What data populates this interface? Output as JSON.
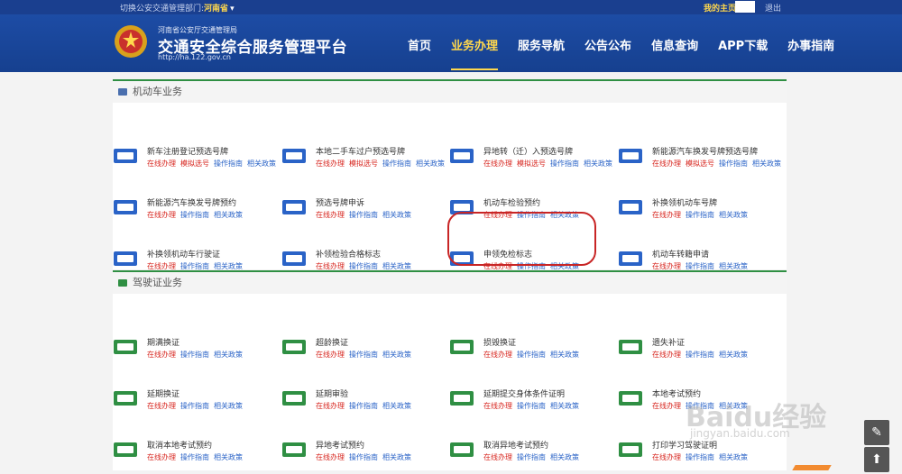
{
  "topbar": {
    "switch_label": "切换公安交通管理部门:",
    "province": "河南省",
    "caret": "▾",
    "me": "我的主页",
    "logout": "退出"
  },
  "header": {
    "org": "河南省公安厅交通管理局",
    "sitename": "交通安全综合服务管理平台",
    "url": "http://ha.122.gov.cn"
  },
  "nav": [
    "首页",
    "业务办理",
    "服务导航",
    "公告公布",
    "信息查询",
    "APP下载",
    "办事指南"
  ],
  "sections": {
    "vehicle": {
      "title": "机动车业务",
      "cards": [
        {
          "title": "新车注册登记预选号牌",
          "links": [
            "在线办理",
            "模拟选号",
            "操作指南",
            "相关政策"
          ]
        },
        {
          "title": "本地二手车过户预选号牌",
          "links": [
            "在线办理",
            "模拟选号",
            "操作指南",
            "相关政策"
          ]
        },
        {
          "title": "异地转（迁）入预选号牌",
          "links": [
            "在线办理",
            "模拟选号",
            "操作指南",
            "相关政策"
          ]
        },
        {
          "title": "新能源汽车换发号牌预选号牌",
          "links": [
            "在线办理",
            "模拟选号",
            "操作指南",
            "相关政策"
          ]
        },
        {
          "title": "新能源汽车换发号牌预约",
          "links": [
            "在线办理",
            "操作指南",
            "相关政策"
          ]
        },
        {
          "title": "预选号牌申诉",
          "links": [
            "在线办理",
            "操作指南",
            "相关政策"
          ]
        },
        {
          "title": "机动车检验预约",
          "links": [
            "在线办理",
            "操作指南",
            "相关政策"
          ]
        },
        {
          "title": "补换领机动车号牌",
          "links": [
            "在线办理",
            "操作指南",
            "相关政策"
          ]
        },
        {
          "title": "补换领机动车行驶证",
          "links": [
            "在线办理",
            "操作指南",
            "相关政策"
          ]
        },
        {
          "title": "补领检验合格标志",
          "links": [
            "在线办理",
            "操作指南",
            "相关政策"
          ]
        },
        {
          "title": "申领免检标志",
          "links": [
            "在线办理",
            "操作指南",
            "相关政策"
          ]
        },
        {
          "title": "机动车转籍申请",
          "links": [
            "在线办理",
            "操作指南",
            "相关政策"
          ]
        }
      ]
    },
    "license": {
      "title": "驾驶证业务",
      "cards": [
        {
          "title": "期满换证",
          "links": [
            "在线办理",
            "操作指南",
            "相关政策"
          ]
        },
        {
          "title": "超龄换证",
          "links": [
            "在线办理",
            "操作指南",
            "相关政策"
          ]
        },
        {
          "title": "损毁换证",
          "links": [
            "在线办理",
            "操作指南",
            "相关政策"
          ]
        },
        {
          "title": "遗失补证",
          "links": [
            "在线办理",
            "操作指南",
            "相关政策"
          ]
        },
        {
          "title": "延期换证",
          "links": [
            "在线办理",
            "操作指南",
            "相关政策"
          ]
        },
        {
          "title": "延期审验",
          "links": [
            "在线办理",
            "操作指南",
            "相关政策"
          ]
        },
        {
          "title": "延期提交身体条件证明",
          "links": [
            "在线办理",
            "操作指南",
            "相关政策"
          ]
        },
        {
          "title": "本地考试预约",
          "links": [
            "在线办理",
            "操作指南",
            "相关政策"
          ]
        },
        {
          "title": "取消本地考试预约",
          "links": [
            "在线办理",
            "操作指南",
            "相关政策"
          ]
        },
        {
          "title": "异地考试预约",
          "links": [
            "在线办理",
            "操作指南",
            "相关政策"
          ]
        },
        {
          "title": "取消异地考试预约",
          "links": [
            "在线办理",
            "操作指南",
            "相关政策"
          ]
        },
        {
          "title": "打印学习驾驶证明",
          "links": [
            "在线办理",
            "操作指南",
            "相关政策"
          ]
        }
      ]
    }
  },
  "watermark": {
    "brand": "Baidu经验",
    "url": "jingyan.baidu.com"
  },
  "float": {
    "edit": "✎",
    "top": "⬆"
  },
  "colors": {
    "primary": "#1d4ca5",
    "accent": "#ffd84d",
    "link_red": "#d7251e",
    "link_blue": "#2a63c7",
    "section_line": "#2f8f43",
    "annotation": "#c82525"
  }
}
